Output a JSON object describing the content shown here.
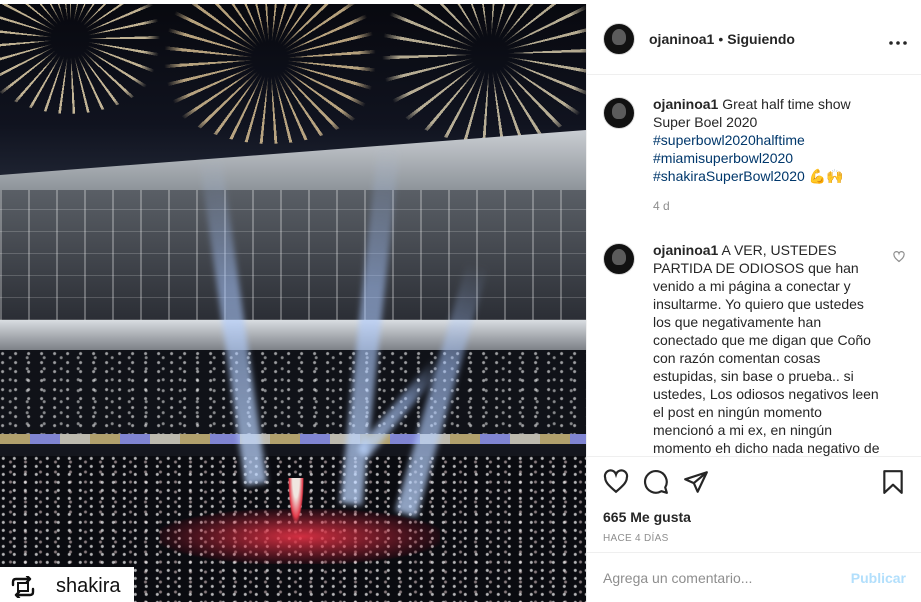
{
  "photo": {
    "repost_icon": "repost-icon",
    "repost_user": "shakira"
  },
  "header": {
    "username": "ojaninoa1",
    "separator": "•",
    "follow_status": "Siguiendo",
    "more_icon": "more-options-icon"
  },
  "caption": {
    "username": "ojaninoa1",
    "text": "Great half time show Super Boel 2020",
    "hashtags": [
      "#superbowl2020halftime",
      "#miamisuperbowl2020",
      "#shakiraSuperBowl2020"
    ],
    "emojis": "💪🙌",
    "age": "4 d"
  },
  "comments": [
    {
      "username": "ojaninoa1",
      "text": "A VER, USTEDES PARTIDA DE ODIOSOS que han venido a mi página a conectar y insultarme. Yo quiero que ustedes los que negativamente han conectado que me digan que Coño con razón comentan cosas estupidas, sin base o prueba.. si ustedes, Los odiosos negativos leen el post en ningún momento mencionó a mi ex, en ningún momento eh dicho nada negativo de esa señora que para mí está"
    }
  ],
  "actions": {
    "like_icon": "heart-icon",
    "comment_icon": "comment-icon",
    "share_icon": "share-icon",
    "save_icon": "bookmark-icon",
    "likes": "665 Me gusta",
    "posted": "HACE 4 DÍAS"
  },
  "add_comment": {
    "placeholder": "Agrega un comentario...",
    "publish": "Publicar"
  },
  "colors": {
    "hashtag": "#00376b",
    "muted": "#8e8e8e",
    "publish_disabled": "#b2dffc"
  }
}
